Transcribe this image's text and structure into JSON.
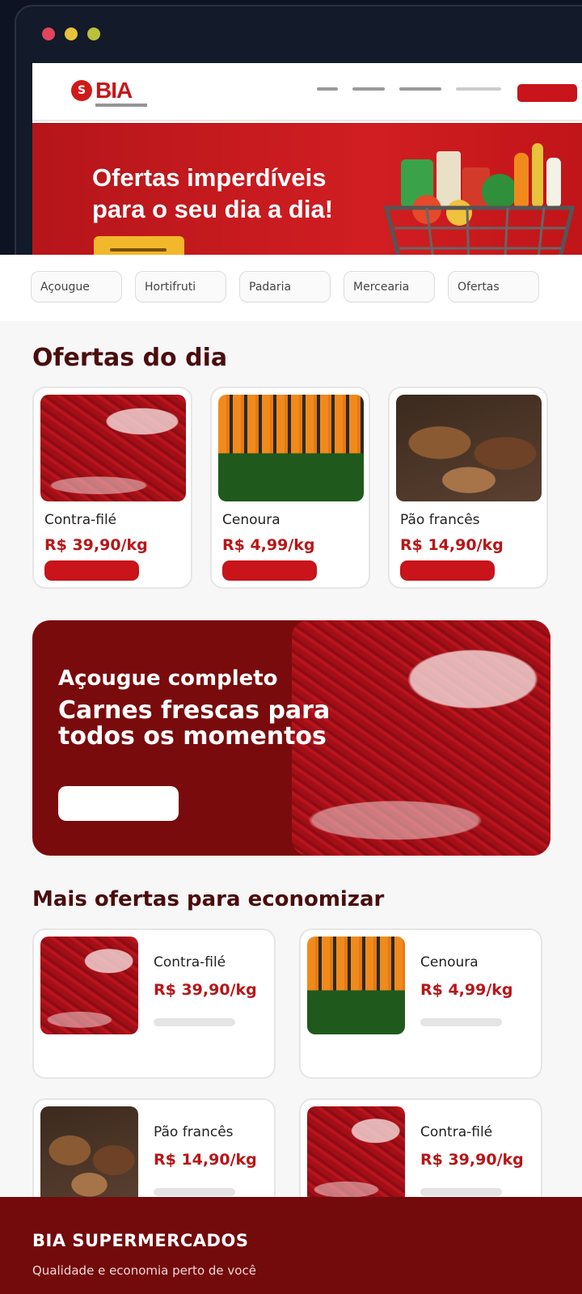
{
  "hero": {
    "logo_text": "BIA",
    "logo_badge": "S",
    "banner_headline": "Ofertas imperdíveis para o seu dia a dia!"
  },
  "categories": [
    "Açougue",
    "Hortifruti",
    "Padaria",
    "Mercearia",
    "Ofertas"
  ],
  "daily_offers": {
    "title": "Ofertas do dia",
    "items": [
      {
        "name": "Contra-filé",
        "price": "R$ 39,90/kg",
        "image": "meat"
      },
      {
        "name": "Cenoura",
        "price": "R$ 4,99/kg",
        "image": "carrot"
      },
      {
        "name": "Pão francês",
        "price": "R$ 14,90/kg",
        "image": "bread"
      }
    ]
  },
  "promo": {
    "eyebrow": "Açougue completo",
    "headline": "Carnes frescas para todos os momentos"
  },
  "more_offers": {
    "title": "Mais ofertas para economizar",
    "items": [
      {
        "name": "Contra-filé",
        "price": "R$ 39,90/kg",
        "image": "meat"
      },
      {
        "name": "Cenoura",
        "price": "R$ 4,99/kg",
        "image": "carrot"
      },
      {
        "name": "Pão francês",
        "price": "R$ 14,90/kg",
        "image": "bread"
      },
      {
        "name": "Contra-filé",
        "price": "R$ 39,90/kg",
        "image": "meat"
      }
    ]
  },
  "footer": {
    "brand": "BIA SUPERMERCADOS",
    "tagline": "Qualidade e economia perto de você"
  },
  "colors": {
    "brand_red": "#c8141a",
    "dark_red": "#7a0b0d",
    "title_brown": "#4a0d0d"
  }
}
